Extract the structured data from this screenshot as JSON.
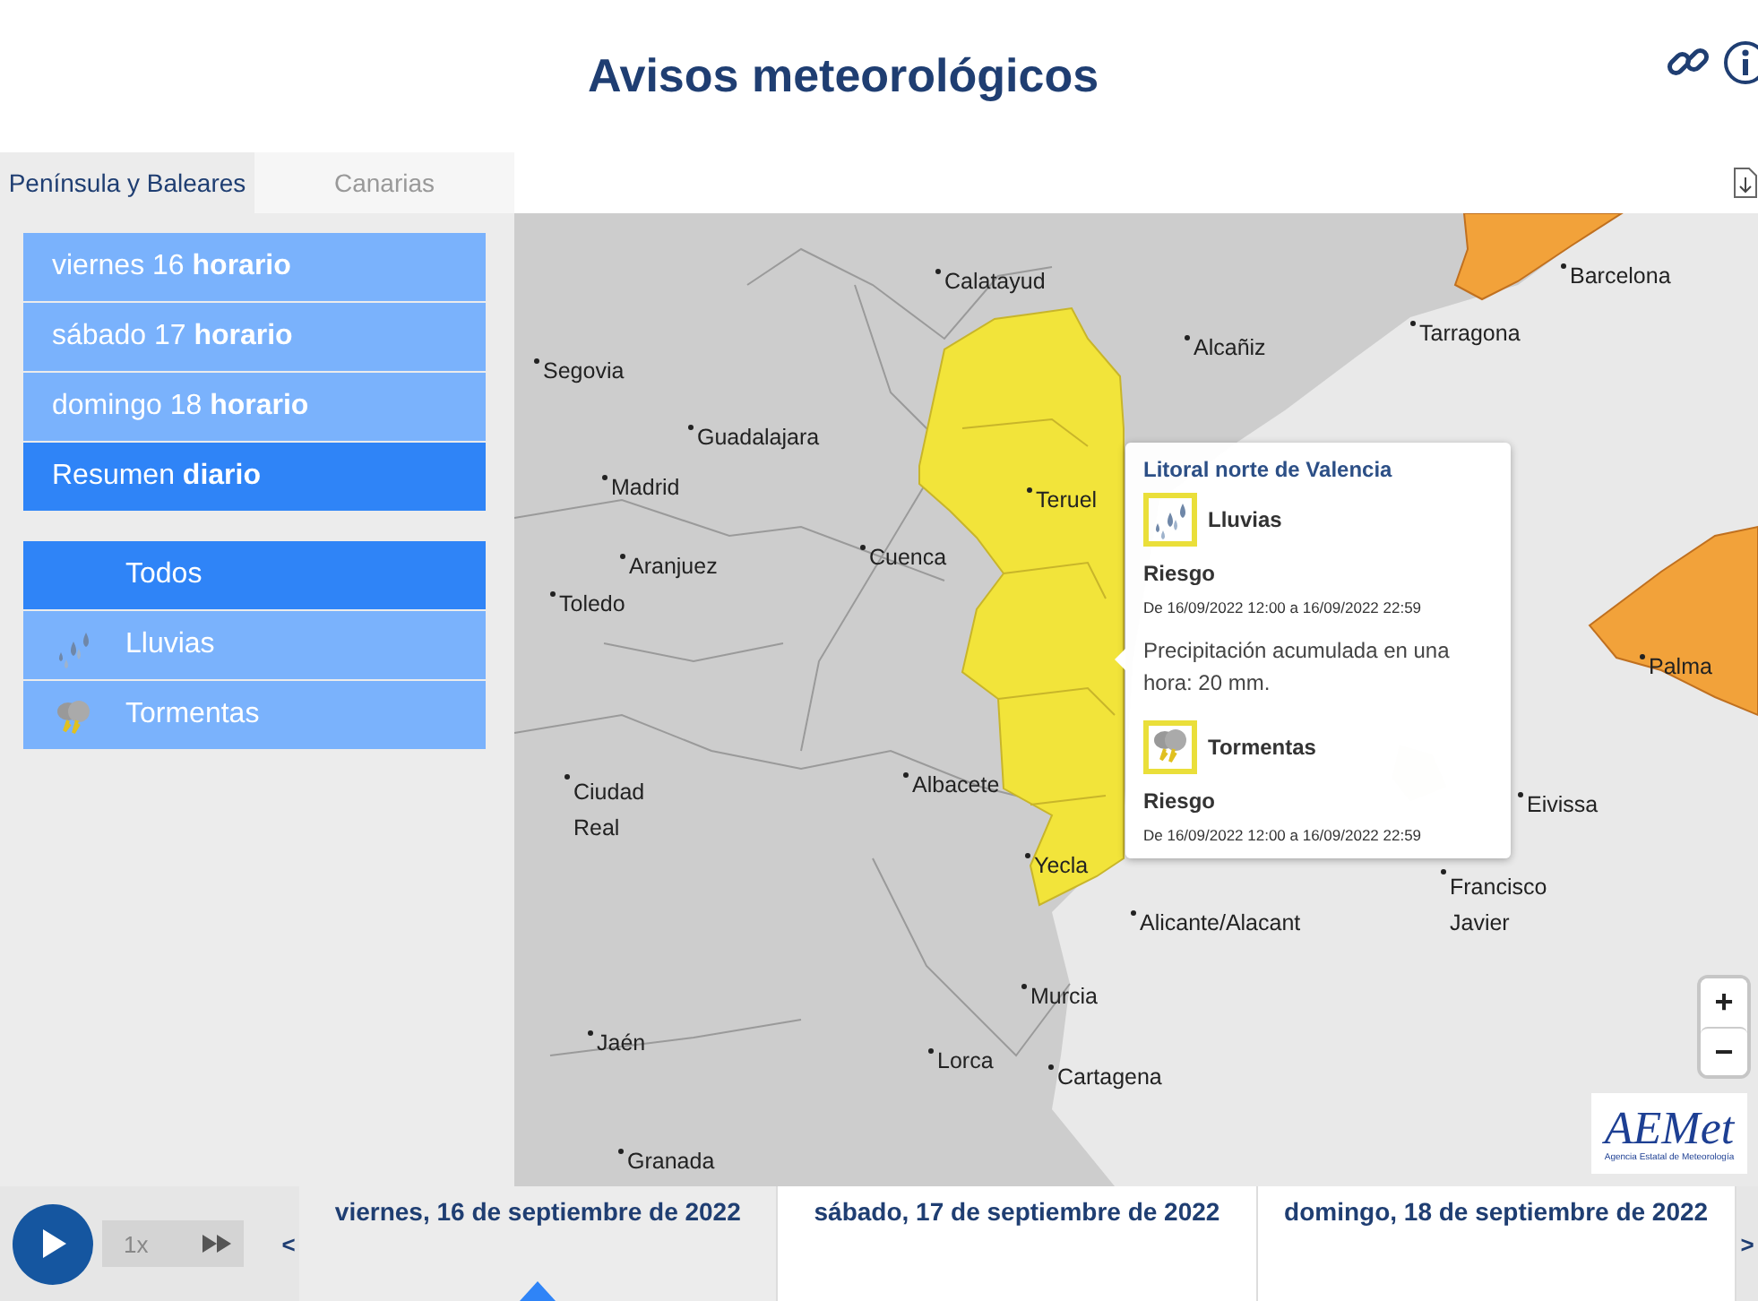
{
  "header": {
    "title": "Avisos meteorológicos"
  },
  "region_tabs": [
    {
      "label": "Península y Baleares",
      "selected": true
    },
    {
      "label": "Canarias",
      "selected": false
    }
  ],
  "day_menu": [
    {
      "label": "viernes 16 **horario**",
      "selected": false
    },
    {
      "label": "sábado 17 **horario**",
      "selected": false
    },
    {
      "label": "domingo 18 **horario**",
      "selected": false
    },
    {
      "label": "Resumen **diario**",
      "selected": true
    }
  ],
  "phenomena": [
    {
      "kind": "all",
      "label": "Todos",
      "selected": true
    },
    {
      "kind": "rain",
      "label": "Lluvias",
      "selected": false
    },
    {
      "kind": "storm",
      "label": "Tormentas",
      "selected": false
    }
  ],
  "map": {
    "places": [
      "Calatayud",
      "Segovia",
      "Guadalajara",
      "Madrid",
      "Aranjuez",
      "Toledo",
      "Cuenca",
      "Teruel",
      "Alcañiz",
      "Tarragona",
      "Barcelona",
      "Ciudad Real",
      "Albacete",
      "Yecla",
      "Eivissa",
      "Alicante/Alacant",
      "Francisco Javier",
      "Murcia",
      "Lorca",
      "Cartagena",
      "Jaén",
      "Granada",
      "Palma"
    ],
    "popup": {
      "title": "Litoral norte de Valencia",
      "warnings": [
        {
          "kind": "rain",
          "name": "Lluvias",
          "risk_label": "Riesgo",
          "period": "De 16/09/2022 12:00 a 16/09/2022 22:59",
          "description": "Precipitación acumulada en una hora: 20 mm."
        },
        {
          "kind": "storm",
          "name": "Tormentas",
          "risk_label": "Riesgo",
          "period": "De 16/09/2022 12:00 a 16/09/2022 22:59"
        }
      ]
    },
    "zoom_in": "+",
    "zoom_out": "−",
    "logo": {
      "text": "AEMet",
      "subtitle": "Agencia Estatal de Meteorología"
    }
  },
  "timeline": {
    "speed": "1x",
    "prev": "<",
    "next": ">",
    "days": [
      {
        "label": "viernes, 16 de septiembre de 2022",
        "selected": true
      },
      {
        "label": "sábado, 17 de septiembre de 2022",
        "selected": false
      },
      {
        "label": "domingo, 18 de septiembre de 2022",
        "selected": false
      }
    ]
  }
}
